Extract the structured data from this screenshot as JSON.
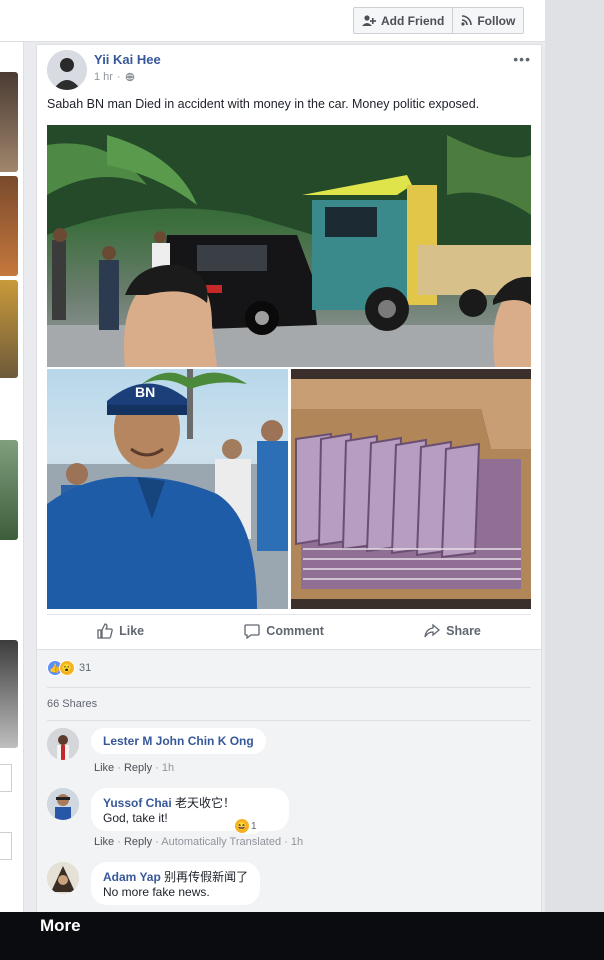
{
  "header": {
    "add_friend_label": "Add Friend",
    "follow_label": "Follow"
  },
  "post": {
    "author": "Yii Kai Hee",
    "time": "1 hr",
    "privacy_icon": "globe-icon",
    "options_icon": "more-options-icon",
    "text": "Sabah BN man Died in accident with money in the car. Money politic exposed.",
    "photos": [
      "crash-photo",
      "politician-photo",
      "cash-box-photo"
    ],
    "actions": {
      "like": "Like",
      "comment": "Comment",
      "share": "Share"
    }
  },
  "reactions": {
    "icons": [
      "like-reaction-icon",
      "wow-reaction-icon"
    ],
    "count": "31",
    "shares": "66 Shares"
  },
  "comments": [
    {
      "name": "Lester M John",
      "tagged": "Chin K Ong",
      "text": "",
      "links": [
        "Like",
        "Reply"
      ],
      "time": "1h"
    },
    {
      "name": "Yussof Chai",
      "text": "老天收它！",
      "translation": "God, take it!",
      "links": [
        "Like",
        "Reply"
      ],
      "extra": "Automatically Translated",
      "time": "1h",
      "reaction_count": "1"
    },
    {
      "name": "Adam Yap",
      "text": "别再传假新闻了",
      "translation": "No more fake news."
    }
  ],
  "bottom_bar": {
    "label": "More"
  },
  "colors": {
    "link": "#365899",
    "page_bg": "#e9ebee",
    "bar": "#0b0c0f"
  }
}
